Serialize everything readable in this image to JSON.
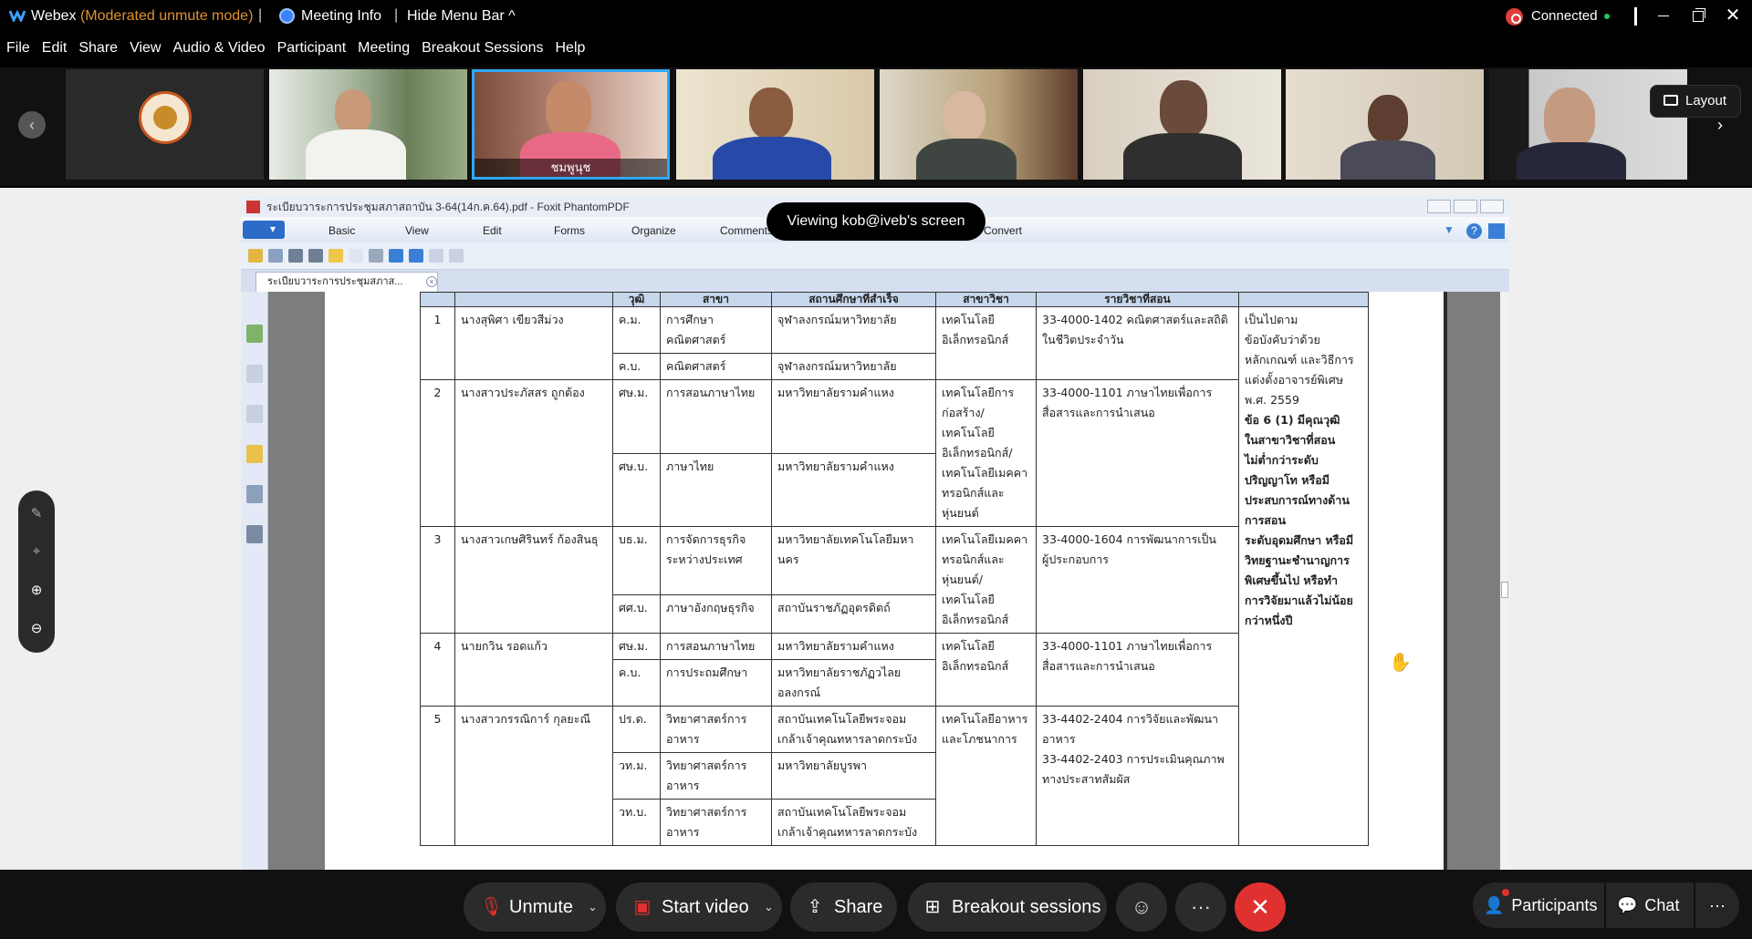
{
  "titlebar": {
    "app_name": "Webex",
    "mode": "(Moderated unmute mode)",
    "meeting_info": "Meeting Info",
    "hide_menu": "Hide Menu Bar ^",
    "connection": "Connected"
  },
  "menu": [
    "File",
    "Edit",
    "Share",
    "View",
    "Audio & Video",
    "Participant",
    "Meeting",
    "Breakout Sessions",
    "Help"
  ],
  "video_strip": {
    "active_name": "ชมพูนุช",
    "layout_label": "Layout"
  },
  "viewing_banner": "Viewing kob@iveb's screen",
  "foxit": {
    "window_title": "ระเบียบวาระการประชุมสภาสถาบัน 3-64(14ก.ค.64).pdf - Foxit PhantomPDF",
    "ribbon_tabs": [
      "Basic",
      "View",
      "Edit",
      "Forms",
      "Organize",
      "Comments",
      "Convert"
    ],
    "doc_tab": "ระเบียบวาระการประชุมสภาส..."
  },
  "table": {
    "headers": [
      "",
      "",
      "วุฒิ",
      "สาขา",
      "สถานศึกษาที่สำเร็จ",
      "สาขาวิชา",
      "รายวิชาที่สอน",
      ""
    ],
    "rows": [
      {
        "no": "1",
        "name": "นางสุพิศา  เขียวสีม่วง",
        "degrees": [
          {
            "deg": "ค.ม.",
            "field": "การศึกษา\nคณิตศาสตร์",
            "inst": "จุฬาลงกรณ์มหาวิทยาลัย"
          },
          {
            "deg": "ค.บ.",
            "field": "คณิตศาสตร์",
            "inst": "จุฬาลงกรณ์มหาวิทยาลัย"
          }
        ],
        "major": "เทคโนโลยี\nอิเล็กทรอนิกส์",
        "courses": "33-4000-1402 คณิตศาสตร์และสถิติ\nในชีวิตประจำวัน"
      },
      {
        "no": "2",
        "name": "นางสาวประภัสสร  ถูกต้อง",
        "degrees": [
          {
            "deg": "ศษ.ม.",
            "field": "การสอนภาษาไทย",
            "inst": "มหาวิทยาลัยรามคำแหง"
          },
          {
            "deg": "ศษ.บ.",
            "field": "ภาษาไทย",
            "inst": "มหาวิทยาลัยรามคำแหง"
          }
        ],
        "major": "เทคโนโลยีการ\nก่อสร้าง/\nเทคโนโลยี\nอิเล็กทรอนิกส์/\nเทคโนโลยีเมคคา\nทรอนิกส์และ\nหุ่นยนต์",
        "courses": "33-4000-1101 ภาษาไทยเพื่อการ\nสื่อสารและการนำเสนอ"
      },
      {
        "no": "3",
        "name": "นางสาวเกษศิรินทร์  ก้องสินธุ",
        "degrees": [
          {
            "deg": "บธ.ม.",
            "field": "การจัดการธุรกิจ\nระหว่างประเทศ",
            "inst": "มหาวิทยาลัยเทคโนโลยีมหา\nนคร"
          },
          {
            "deg": "ศศ.บ.",
            "field": "ภาษาอังกฤษธุรกิจ",
            "inst": "สถาบันราชภัฏอุตรดิตถ์"
          }
        ],
        "major": "เทคโนโลยีเมคคา\nทรอนิกส์และ\nหุ่นยนต์/\nเทคโนโลยี\nอิเล็กทรอนิกส์",
        "courses": "33-4000-1604 การพัฒนาการเป็น\nผู้ประกอบการ"
      },
      {
        "no": "4",
        "name": "นายกวิน  รอดแก้ว",
        "degrees": [
          {
            "deg": "ศษ.ม.",
            "field": "การสอนภาษาไทย",
            "inst": "มหาวิทยาลัยรามคำแหง"
          },
          {
            "deg": "ค.บ.",
            "field": "การประถมศึกษา",
            "inst": "มหาวิทยาลัยราชภัฏวไลย\nอลงกรณ์"
          }
        ],
        "major": "เทคโนโลยี\nอิเล็กทรอนิกส์",
        "courses": "33-4000-1101 ภาษาไทยเพื่อการ\nสื่อสารและการนำเสนอ"
      },
      {
        "no": "5",
        "name": "นางสาวกรรณิการ์  กุลยะณี",
        "degrees": [
          {
            "deg": "ปร.ด.",
            "field": "วิทยาศาสตร์การ\nอาหาร",
            "inst": "สถาบันเทคโนโลยีพระจอม\nเกล้าเจ้าคุณทหารลาดกระบัง"
          },
          {
            "deg": "วท.ม.",
            "field": "วิทยาศาสตร์การ\nอาหาร",
            "inst": "มหาวิทยาลัยบูรพา"
          },
          {
            "deg": "วท.บ.",
            "field": "วิทยาศาสตร์การ\nอาหาร",
            "inst": "สถาบันเทคโนโลยีพระจอม\nเกล้าเจ้าคุณทหารลาดกระบัง"
          }
        ],
        "major": "เทคโนโลยีอาหาร\nและโภชนาการ",
        "courses": "33-4402-2404 การวิจัยและพัฒนา\nอาหาร\n33-4402-2403 การประเมินคุณภาพ\nทางประสาทสัมผัส"
      }
    ],
    "remark_plain": "เป็นไปตาม\nข้อบังคับว่าด้วย\nหลักเกณฑ์ และวิธีการ\nแต่งตั้งอาจารย์พิเศษ\nพ.ศ. 2559",
    "remark_bold": " ข้อ 6 (1) มีคุณวุฒิ\nในสาขาวิชาที่สอน\nไม่ต่ำกว่าระดับ\nปริญญาโท หรือมี\nประสบการณ์ทางด้าน\nการสอน\nระดับอุดมศึกษา หรือมี\nวิทยฐานะชำนาญการ\nพิเศษขึ้นไป หรือทำ\nการวิจัยมาแล้วไม่น้อย\nกว่าหนึ่งปี"
  },
  "controls": {
    "unmute": "Unmute",
    "start_video": "Start video",
    "share": "Share",
    "breakout": "Breakout sessions",
    "participants": "Participants",
    "chat": "Chat"
  }
}
